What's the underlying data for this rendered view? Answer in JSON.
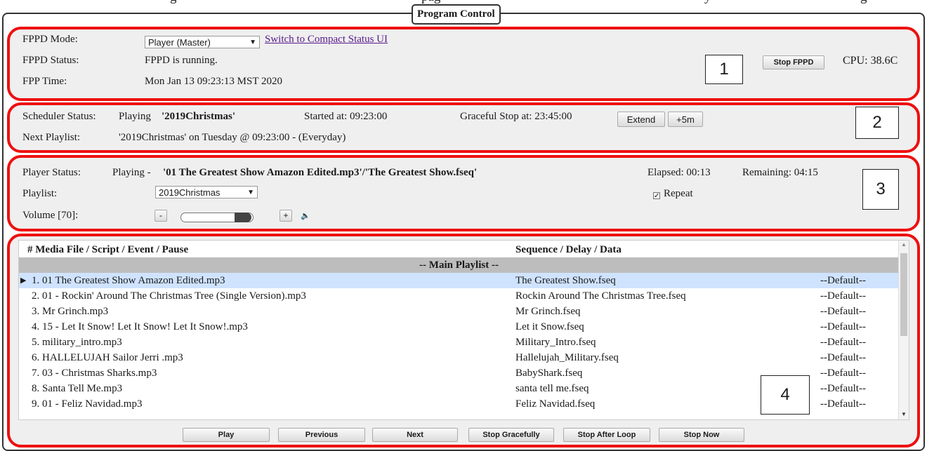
{
  "top_text": [
    "g",
    "pag",
    "y",
    "g"
  ],
  "legend": "Program Control",
  "section1": {
    "mode_label": "FPPD Mode:",
    "mode_value": "Player (Master)",
    "compact_link": "Switch to Compact Status UI",
    "status_label": "FPPD Status:",
    "status_value": "FPPD is running.",
    "time_label": "FPP Time:",
    "time_value": "Mon Jan 13 09:23:13 MST 2020",
    "stop_button": "Stop FPPD",
    "cpu": "CPU: 38.6C",
    "marker": "1"
  },
  "section2": {
    "sched_label": "Scheduler Status:",
    "sched_prefix": "Playing",
    "sched_playlist": "'2019Christmas'",
    "started": "Started at: 09:23:00",
    "graceful": "Graceful Stop at: 23:45:00",
    "extend_button": "Extend",
    "plus5_button": "+5m",
    "next_label": "Next Playlist:",
    "next_value": "'2019Christmas' on Tuesday @ 09:23:00 - (Everyday)",
    "marker": "2"
  },
  "section3": {
    "player_label": "Player Status:",
    "player_prefix": "Playing -",
    "player_value": "'01 The Greatest Show Amazon Edited.mp3'/'The Greatest Show.fseq'",
    "elapsed": "Elapsed: 00:13",
    "remaining": "Remaining: 04:15",
    "playlist_label": "Playlist:",
    "playlist_value": "2019Christmas",
    "repeat_label": "Repeat",
    "repeat_checked": true,
    "volume_label": "Volume [70]:",
    "volume_level": 0.7,
    "minus_button": "-",
    "plus_button": "+",
    "marker": "3"
  },
  "section4": {
    "columns": [
      "# Media File / Script / Event / Pause",
      "Sequence / Delay / Data"
    ],
    "section_header": "-- Main Playlist --",
    "rows": [
      {
        "media": "1. 01 The Greatest Show Amazon Edited.mp3",
        "sequence": "The Greatest Show.fseq",
        "data": "--Default--",
        "current": true
      },
      {
        "media": "2. 01 - Rockin' Around The Christmas Tree (Single Version).mp3",
        "sequence": "Rockin Around The Christmas Tree.fseq",
        "data": "--Default--"
      },
      {
        "media": "3. Mr Grinch.mp3",
        "sequence": "Mr Grinch.fseq",
        "data": "--Default--"
      },
      {
        "media": "4. 15 - Let It Snow! Let It Snow! Let It Snow!.mp3",
        "sequence": "Let it Snow.fseq",
        "data": "--Default--"
      },
      {
        "media": "5. military_intro.mp3",
        "sequence": "Military_Intro.fseq",
        "data": "--Default--"
      },
      {
        "media": "6. HALLELUJAH Sailor Jerri .mp3",
        "sequence": "Hallelujah_Military.fseq",
        "data": "--Default--"
      },
      {
        "media": "7. 03 - Christmas Sharks.mp3",
        "sequence": "BabyShark.fseq",
        "data": "--Default--"
      },
      {
        "media": "8. Santa Tell Me.mp3",
        "sequence": "santa tell me.fseq",
        "data": "--Default--"
      },
      {
        "media": "9. 01 - Feliz Navidad.mp3",
        "sequence": "Feliz Navidad.fseq",
        "data": "--Default--"
      }
    ],
    "buttons": {
      "play": "Play",
      "previous": "Previous",
      "next": "Next",
      "stop_gracefully": "Stop Gracefully",
      "stop_after_loop": "Stop After Loop",
      "stop_now": "Stop Now"
    },
    "marker": "4"
  },
  "colors": {
    "annotation_red": "#ee1010",
    "panel_bg": "#efefef",
    "header_bar": "#bdbdbd",
    "current_row": "#cfe3ff",
    "link": "#551a8b"
  },
  "icons": [
    "dropdown-arrow-icon",
    "volume-speaker-icon",
    "play-indicator-icon",
    "checkbox-icon",
    "scroll-up-arrow-icon",
    "scroll-down-arrow-icon"
  ]
}
